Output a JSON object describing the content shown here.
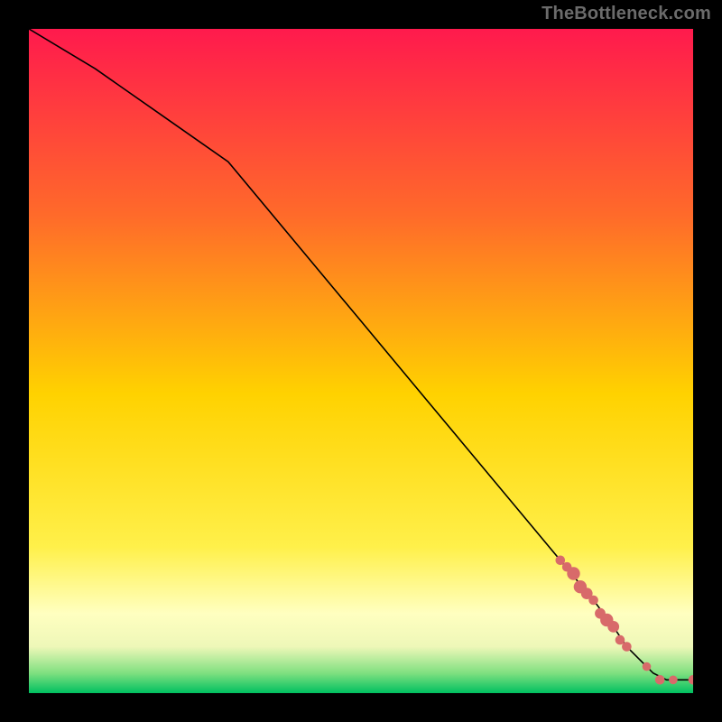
{
  "watermark": "TheBottleneck.com",
  "colors": {
    "marker": "#d86a6a",
    "line": "#000000",
    "gradient_top": "#ff1a4d",
    "gradient_orange": "#ff8a2a",
    "gradient_yellow": "#ffe600",
    "gradient_pale_yellow": "#ffff99",
    "gradient_cream": "#f0f7c0",
    "gradient_green": "#00c060",
    "frame": "#000000"
  },
  "chart_data": {
    "type": "line",
    "title": "",
    "xlabel": "",
    "ylabel": "",
    "xlim": [
      0,
      100
    ],
    "ylim": [
      0,
      100
    ],
    "series": [
      {
        "name": "curve",
        "x": [
          0,
          10,
          20,
          30,
          40,
          50,
          60,
          70,
          80,
          85,
          88,
          90,
          92,
          94,
          96,
          98,
          100
        ],
        "y": [
          100,
          94,
          87,
          80,
          68,
          56,
          44,
          32,
          20,
          14,
          10,
          7,
          5,
          3,
          2,
          2,
          2
        ]
      }
    ],
    "markers": {
      "name": "points",
      "x": [
        80,
        81,
        82,
        83,
        84,
        85,
        86,
        87,
        88,
        89,
        90,
        93,
        95,
        97,
        100
      ],
      "y": [
        20,
        19,
        18,
        16,
        15,
        14,
        12,
        11,
        10,
        8,
        7,
        4,
        2,
        2,
        2
      ],
      "r": [
        3.3,
        3.3,
        4.5,
        4.5,
        4.0,
        3.3,
        3.7,
        4.5,
        4.0,
        3.3,
        3.3,
        3.0,
        3.3,
        3.0,
        3.3
      ]
    }
  }
}
